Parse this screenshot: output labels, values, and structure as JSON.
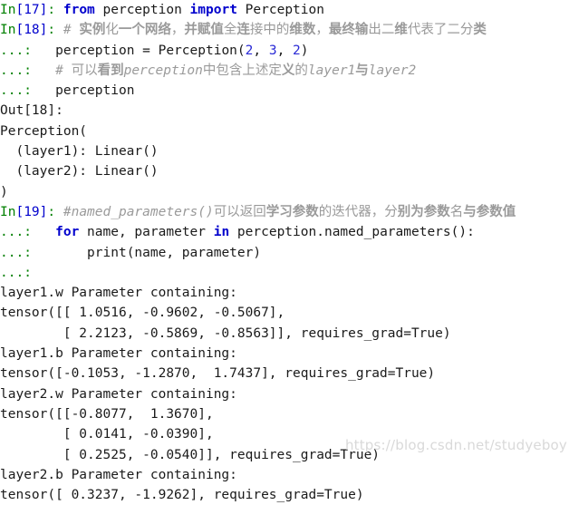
{
  "console": {
    "kind": "ipython-session",
    "watermark": "https://blog.csdn.net/studyeboy",
    "colors": {
      "background": "#ffffff",
      "prompt_in": "#008000",
      "prompt_number": "#0000cd",
      "keyword": "#0000cd",
      "number": "#2b2bd6",
      "comment": "#9a9a9a",
      "output": "#1a1a1a",
      "watermark": "#d9d9d9"
    },
    "prompts": {
      "in_17": "In[17]:",
      "in_18": "In[18]:",
      "in_19": "In[19]:",
      "out_18": "Out[18]:",
      "continuation": "...:"
    },
    "cells": [
      {
        "prompt": "In[17]:",
        "lines": [
          {
            "type": "code",
            "text": "from perception import Perception"
          }
        ]
      },
      {
        "prompt": "In[18]:",
        "lines": [
          {
            "type": "comment",
            "text": "# 实例化一个网络，并赋值全连接中的维数，最终输出二维代表了二分类"
          },
          {
            "type": "code",
            "text": "perception = Perception(2, 3, 2)"
          },
          {
            "type": "comment",
            "text": "# 可以看到perception中包含上述定义的layer1与layer2"
          },
          {
            "type": "code",
            "text": "perception"
          }
        ]
      },
      {
        "prompt": "Out[18]:",
        "lines": [
          {
            "type": "output",
            "text": "Perception("
          },
          {
            "type": "output",
            "text": "  (layer1): Linear()"
          },
          {
            "type": "output",
            "text": "  (layer2): Linear()"
          },
          {
            "type": "output",
            "text": ")"
          }
        ]
      },
      {
        "prompt": "In[19]:",
        "lines": [
          {
            "type": "comment",
            "text": "#named_parameters()可以返回学习参数的迭代器，分别为参数名与参数值"
          },
          {
            "type": "code",
            "text": "for name, parameter in perception.named_parameters():"
          },
          {
            "type": "code",
            "text": "    print(name, parameter)"
          },
          {
            "type": "code",
            "text": ""
          }
        ]
      }
    ],
    "output_block": [
      "layer1.w Parameter containing:",
      "tensor([[ 1.0516, -0.9602, -0.5067],",
      "        [ 2.2123, -0.5869, -0.8563]], requires_grad=True)",
      "layer1.b Parameter containing:",
      "tensor([-0.1053, -1.2870,  1.7437], requires_grad=True)",
      "layer2.w Parameter containing:",
      "tensor([[-0.8077,  1.3670],",
      "        [ 0.0141, -0.0390],",
      "        [ 0.2525, -0.0540]], requires_grad=True)",
      "layer2.b Parameter containing:",
      "tensor([ 0.3237, -1.9262], requires_grad=True)"
    ],
    "tokens": {
      "kw_from": "from",
      "kw_import": "import",
      "kw_for": "for",
      "kw_in": "in",
      "mod_perception": " perception ",
      "cls_Perception": " Perception",
      "line_assign_a": "perception = Perception(",
      "num_2a": "2",
      "sep_1": ", ",
      "num_3": "3",
      "sep_2": ", ",
      "num_2b": "2",
      "line_assign_b": ")",
      "line_perception": "perception",
      "for_mid": " name, parameter ",
      "for_tail": " perception.named_parameters():",
      "print_line": "    print(name, parameter)"
    }
  }
}
